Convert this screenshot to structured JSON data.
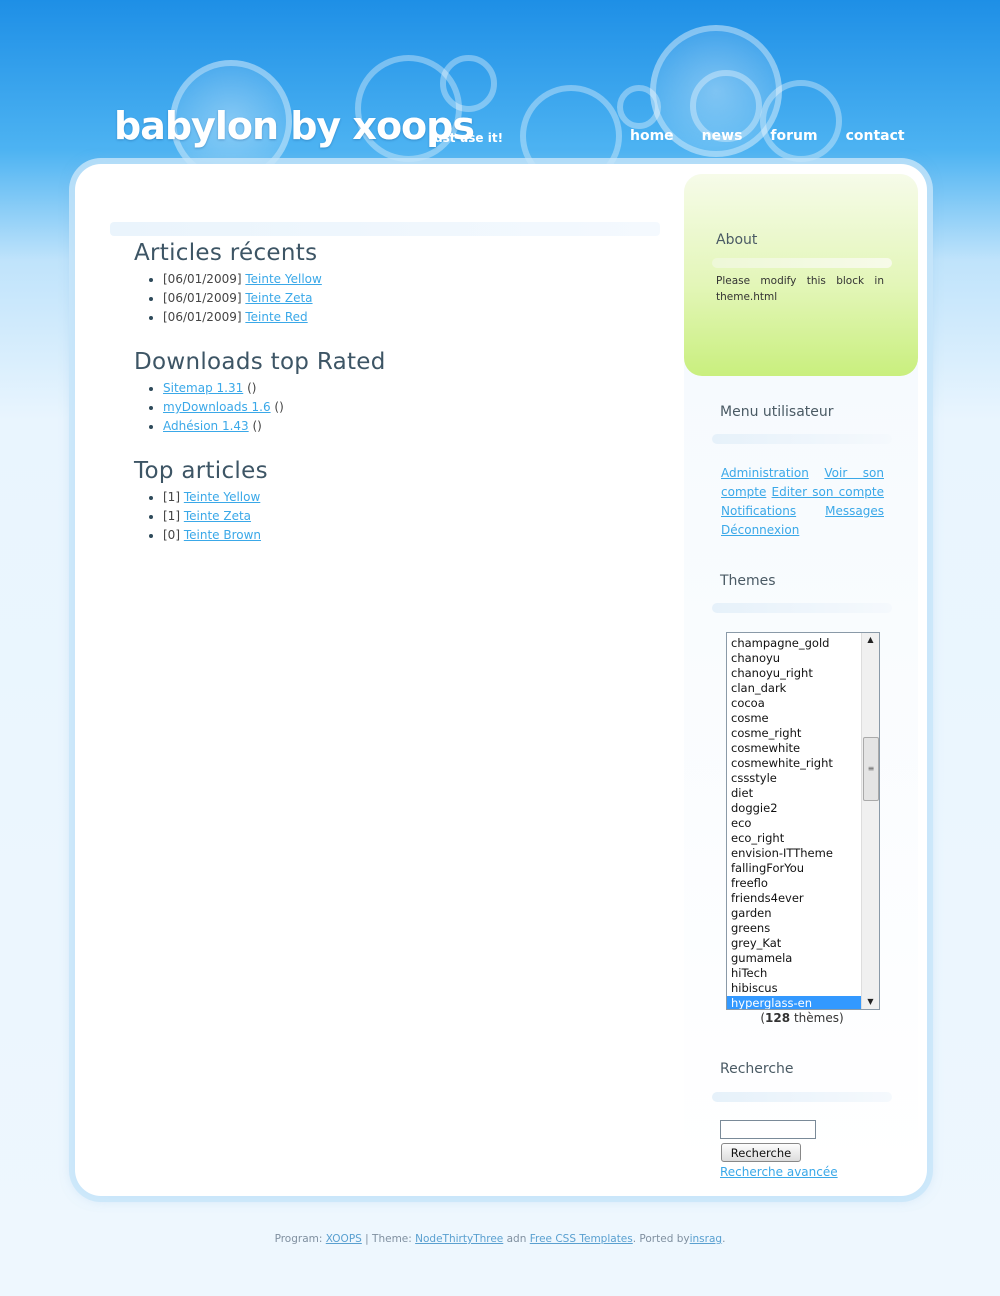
{
  "header": {
    "title": "babylon by xoops",
    "slogan": "just use it!",
    "nav": [
      "home",
      "news",
      "forum",
      "contact"
    ]
  },
  "main": {
    "recent": {
      "title": "Articles récents",
      "items": [
        {
          "date": "[06/01/2009]",
          "link": "Teinte Yellow"
        },
        {
          "date": "[06/01/2009]",
          "link": "Teinte Zeta"
        },
        {
          "date": "[06/01/2009]",
          "link": "Teinte Red"
        }
      ]
    },
    "downloads": {
      "title": "Downloads top Rated",
      "items": [
        {
          "link": "Sitemap 1.31",
          "suffix": "()"
        },
        {
          "link": "myDownloads 1.6",
          "suffix": "()"
        },
        {
          "link": "Adhésion 1.43",
          "suffix": "()"
        }
      ]
    },
    "top": {
      "title": "Top articles",
      "items": [
        {
          "rank": "[1]",
          "link": "Teinte Yellow"
        },
        {
          "rank": "[1]",
          "link": "Teinte Zeta"
        },
        {
          "rank": "[0]",
          "link": "Teinte Brown"
        }
      ]
    }
  },
  "sidebar": {
    "about": {
      "title": "About",
      "text": "Please modify this block in theme.html"
    },
    "usermenu": {
      "title": "Menu utilisateur",
      "links": [
        "Administration",
        "Voir son compte",
        "Editer son compte",
        "Notifications",
        "Messages",
        "Déconnexion"
      ]
    },
    "themes": {
      "title": "Themes",
      "options": [
        "champagne_gold",
        "chanoyu",
        "chanoyu_right",
        "clan_dark",
        "cocoa",
        "cosme",
        "cosme_right",
        "cosmewhite",
        "cosmewhite_right",
        "cssstyle",
        "diet",
        "doggie2",
        "eco",
        "eco_right",
        "envision-ITTheme",
        "fallingForYou",
        "freeflo",
        "friends4ever",
        "garden",
        "greens",
        "grey_Kat",
        "gumamela",
        "hiTech",
        "hibiscus",
        "hyperglass-en"
      ],
      "selected": "hyperglass-en",
      "count_open": "(",
      "count": "128",
      "count_label": "thèmes)"
    },
    "search": {
      "title": "Recherche",
      "button": "Recherche",
      "advanced": "Recherche avancée",
      "value": ""
    }
  },
  "footer": {
    "program_label": "Program:",
    "program_link": "XOOPS",
    "theme_label": "| Theme:",
    "theme_link": "NodeThirtyThree",
    "adn": "adn",
    "templates_link": "Free CSS Templates",
    "ported_label": ". Ported by",
    "ported_link": "insrag",
    "end": "."
  },
  "colors": {
    "link": "#3aa8e8",
    "header_top": "#1e8fe6",
    "about_green": "#c9ef7e",
    "selected_option": "#3399ff"
  }
}
